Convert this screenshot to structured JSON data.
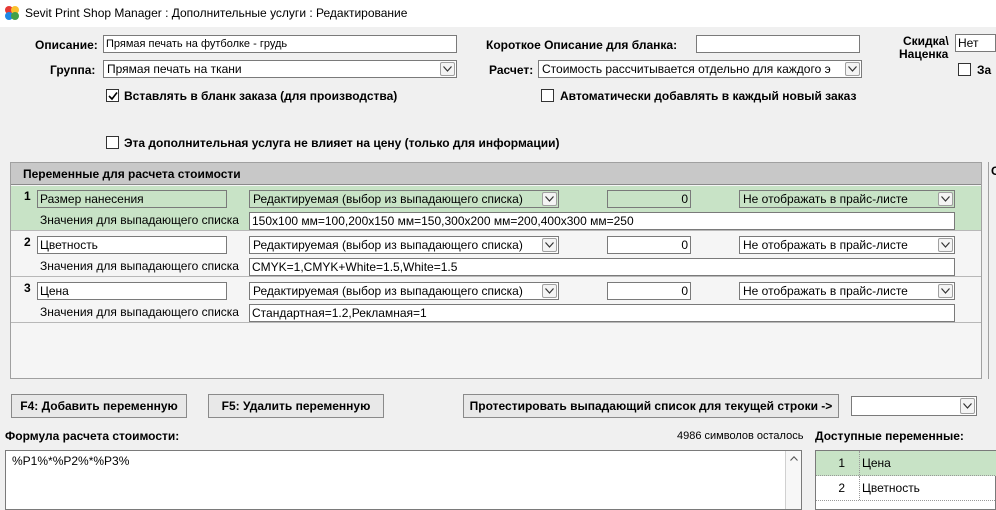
{
  "window": {
    "title": "Sevit Print Shop Manager : Дополнительные услуги : Редактирование"
  },
  "form": {
    "description_label": "Описание:",
    "description_value": "Прямая печать на футболке - грудь",
    "short_description_label": "Короткое Описание для бланка:",
    "short_description_value": "",
    "discount_label_line1": "Скидка\\",
    "discount_label_line2": "Наценка",
    "discount_value": "Нет",
    "right_checkbox_label": "За",
    "group_label": "Группа:",
    "group_value": "Прямая печать на ткани",
    "calc_label": "Расчет:",
    "calc_value": "Стоимость рассчитывается отдельно для каждого э",
    "insert_checkbox_label": "Вставлять в бланк заказа (для производства)",
    "insert_checked": true,
    "auto_add_checkbox_label": "Автоматически добавлять в каждый новый заказ",
    "auto_add_checked": false,
    "no_price_checkbox_label": "Эта дополнительная услуга не влияет на цену (только для информации)",
    "no_price_checked": false
  },
  "variables_panel": {
    "title": "Переменные для расчета стоимости",
    "values_label": "Значения для выпадающего списка",
    "right_header_fragment": "С",
    "rows": [
      {
        "num": "1",
        "name": "Размер нанесения",
        "type": "Редактируемая (выбор из выпадающего списка)",
        "default": "0",
        "price_list": "Не отображать в прайс-листе",
        "values": "150x100 мм=100,200x150 мм=150,300x200 мм=200,400x300 мм=250",
        "selected": true
      },
      {
        "num": "2",
        "name": "Цветность",
        "type": "Редактируемая (выбор из выпадающего списка)",
        "default": "0",
        "price_list": "Не отображать в прайс-листе",
        "values": "CMYK=1,CMYK+White=1.5,White=1.5",
        "selected": false
      },
      {
        "num": "3",
        "name": "Цена",
        "type": "Редактируемая (выбор из выпадающего списка)",
        "default": "0",
        "price_list": "Не отображать в прайс-листе",
        "values": "Стандартная=1.2,Рекламная=1",
        "selected": false
      }
    ]
  },
  "buttons": {
    "add_variable": "F4: Добавить переменную",
    "delete_variable": "F5: Удалить переменную",
    "test_dropdown": "Протестировать выпадающий список для текущей строки ->",
    "test_select_value": ""
  },
  "formula": {
    "label": "Формула расчета стоимости:",
    "chars_left": "4986 символов осталось",
    "value": "%P1%*%P2%*%P3%"
  },
  "available_vars": {
    "label": "Доступные переменные:",
    "items": [
      {
        "num": "1",
        "name": "Цена",
        "selected": true
      },
      {
        "num": "2",
        "name": "Цветность",
        "selected": false
      }
    ]
  },
  "colors": {
    "selected_row": "#c8e3c6",
    "header_bg": "#c8c8c8",
    "window_bg": "#f0f0f0"
  }
}
